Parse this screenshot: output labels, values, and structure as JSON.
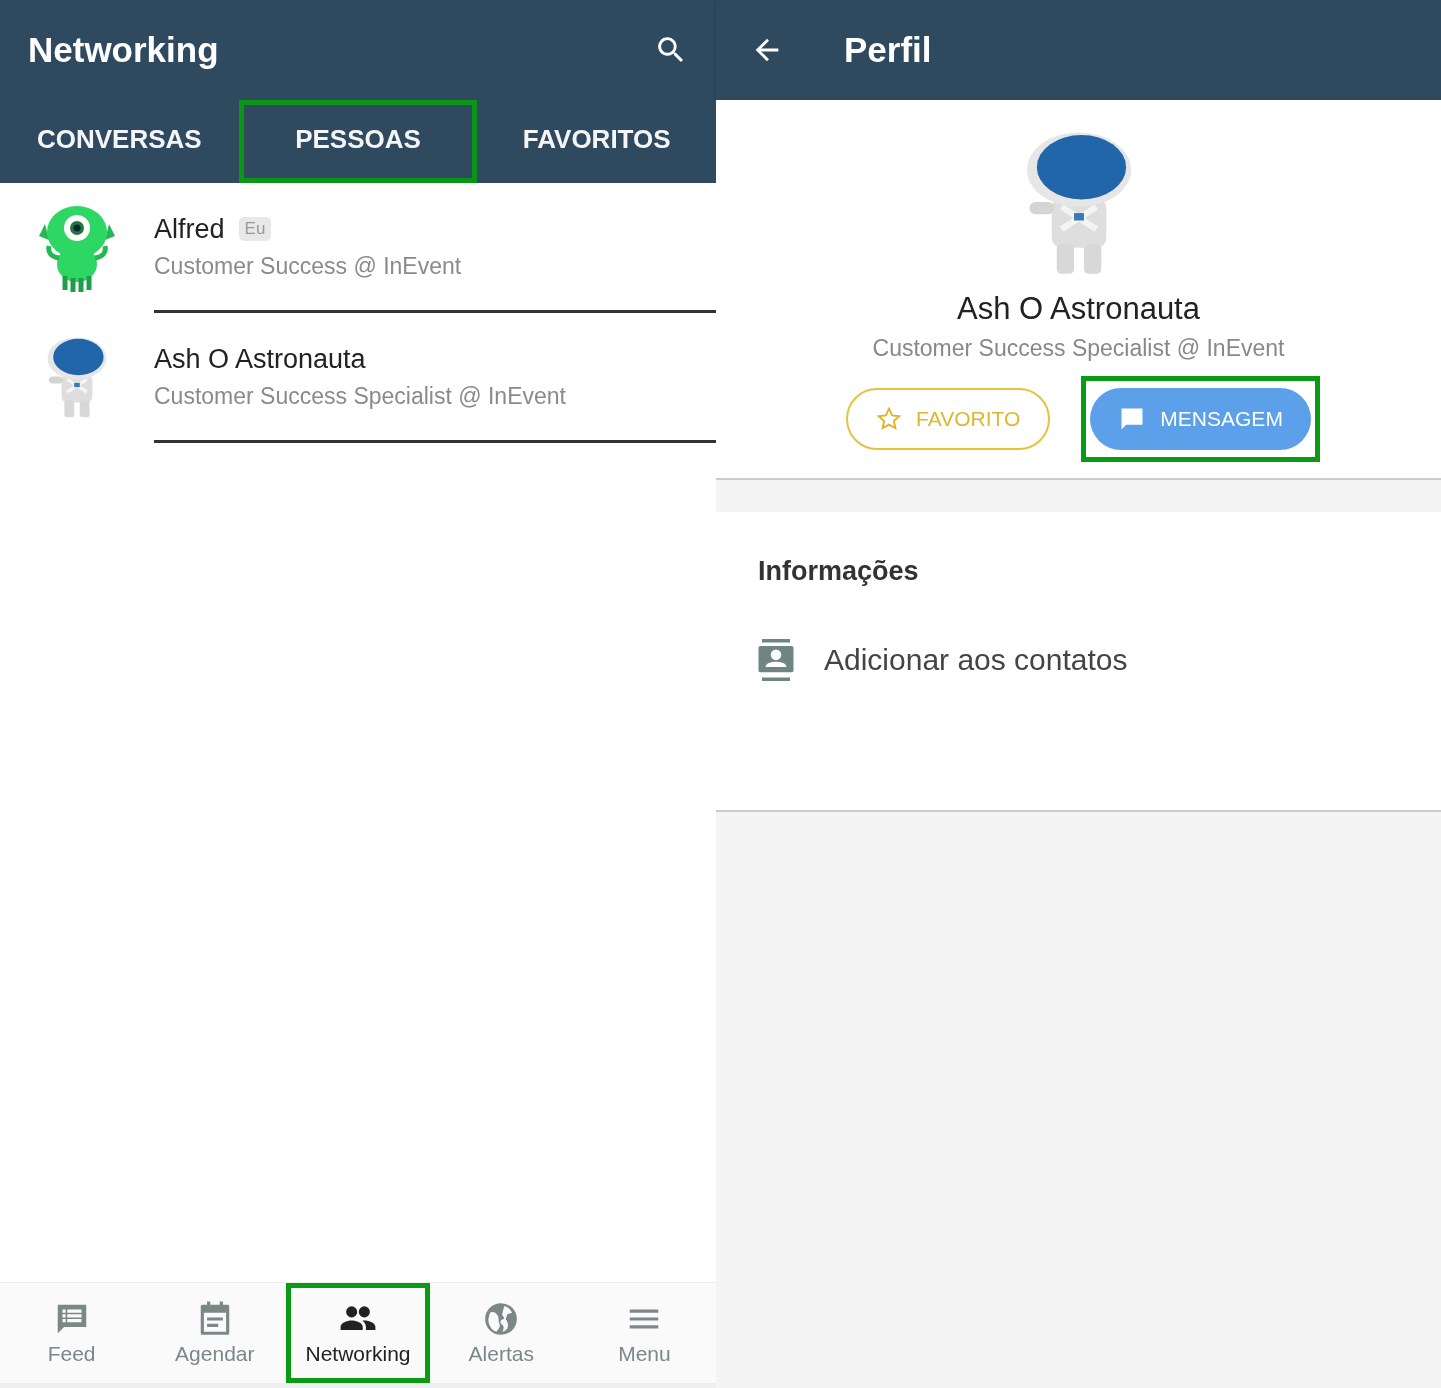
{
  "left_screen": {
    "app_bar": {
      "title": "Networking"
    },
    "tabs": [
      {
        "label": "CONVERSAS",
        "highlighted": false
      },
      {
        "label": "PESSOAS",
        "highlighted": true
      },
      {
        "label": "FAVORITOS",
        "highlighted": false
      }
    ],
    "people": [
      {
        "kind": "alien",
        "name": "Alfred",
        "badge": "Eu",
        "subtitle": "Customer Success @ InEvent"
      },
      {
        "kind": "astronaut",
        "name": "Ash O Astronauta",
        "subtitle": "Customer Success Specialist @ InEvent"
      }
    ],
    "bottom_nav": [
      {
        "kind": "feed",
        "label": "Feed",
        "selected": false,
        "highlighted": false
      },
      {
        "kind": "calendar",
        "label": "Agendar",
        "selected": false,
        "highlighted": false
      },
      {
        "kind": "people",
        "label": "Networking",
        "selected": true,
        "highlighted": true
      },
      {
        "kind": "globe",
        "label": "Alertas",
        "selected": false,
        "highlighted": false
      },
      {
        "kind": "menu",
        "label": "Menu",
        "selected": false,
        "highlighted": false
      }
    ]
  },
  "right_screen": {
    "app_bar": {
      "title": "Perfil"
    },
    "profile": {
      "name": "Ash O Astronauta",
      "subtitle": "Customer Success Specialist @ InEvent"
    },
    "buttons": [
      {
        "kind": "favorite",
        "label": "FAVORITO",
        "highlighted": false
      },
      {
        "kind": "message",
        "label": "MENSAGEM",
        "highlighted": true
      }
    ],
    "info": {
      "title": "Informações",
      "items": [
        {
          "kind": "contact",
          "label": "Adicionar aos contatos"
        }
      ]
    }
  }
}
